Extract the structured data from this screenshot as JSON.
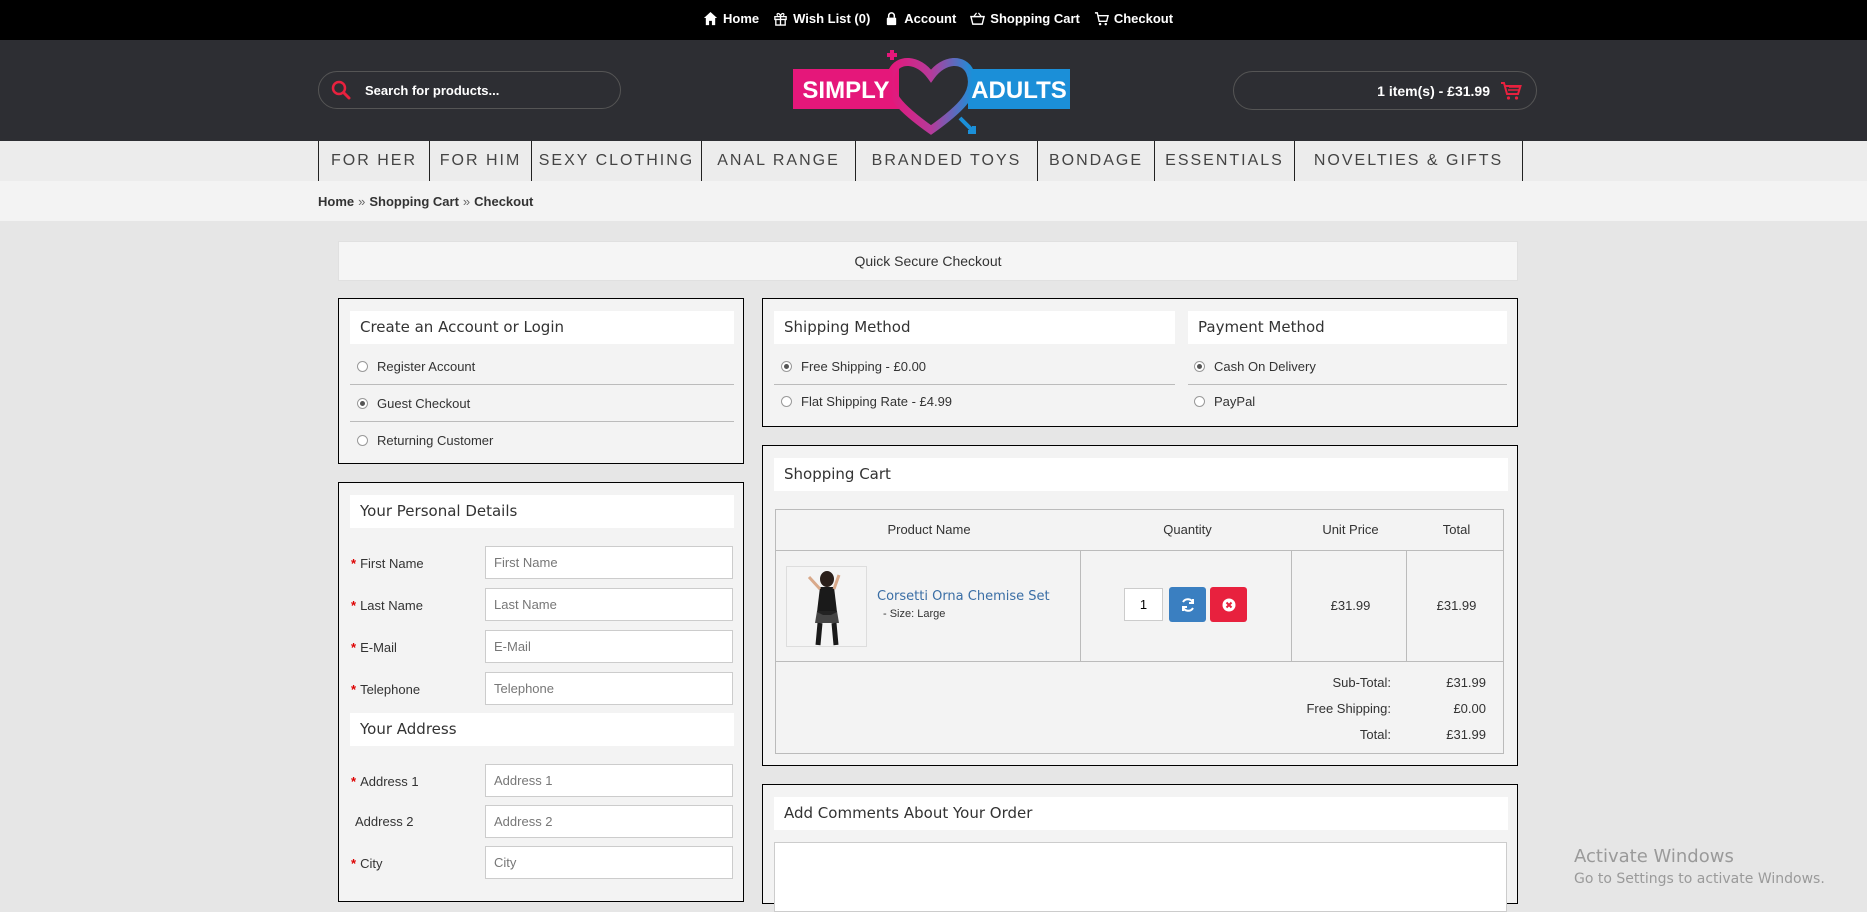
{
  "topnav": {
    "home": "Home",
    "wishlist": "Wish List (0)",
    "account": "Account",
    "cart": "Shopping Cart",
    "checkout": "Checkout"
  },
  "header": {
    "search_placeholder": "Search for products...",
    "cart_summary": "1 item(s) - £31.99",
    "logo_text_left": "SIMPLY",
    "logo_text_right": "ADULTS"
  },
  "mainnav": [
    "FOR HER",
    "FOR HIM",
    "SEXY CLOTHING",
    "ANAL RANGE",
    "BRANDED TOYS",
    "BONDAGE",
    "ESSENTIALS",
    "NOVELTIES & GIFTS"
  ],
  "breadcrumb": [
    "Home",
    "Shopping Cart",
    "Checkout"
  ],
  "breadcrumb_separator": "»",
  "quick_checkout": "Quick Secure Checkout",
  "account_panel": {
    "title": "Create an Account or Login",
    "options": [
      "Register Account",
      "Guest Checkout",
      "Returning Customer"
    ],
    "selected": "Guest Checkout"
  },
  "shipping_panel": {
    "title": "Shipping Method",
    "options": [
      "Free Shipping - £0.00",
      "Flat Shipping Rate - £4.99"
    ],
    "selected": "Free Shipping - £0.00"
  },
  "payment_panel": {
    "title": "Payment Method",
    "options": [
      "Cash On Delivery",
      "PayPal"
    ],
    "selected": "Cash On Delivery"
  },
  "personal": {
    "title": "Your Personal Details",
    "fields": [
      {
        "label": "First Name",
        "placeholder": "First Name",
        "required": "*"
      },
      {
        "label": "Last Name",
        "placeholder": "Last Name",
        "required": "*"
      },
      {
        "label": "E-Mail",
        "placeholder": "E-Mail",
        "required": "*"
      },
      {
        "label": "Telephone",
        "placeholder": "Telephone",
        "required": "*"
      }
    ]
  },
  "address": {
    "title": "Your Address",
    "fields": [
      {
        "label": "Address 1",
        "placeholder": "Address 1",
        "required": "*"
      },
      {
        "label": "Address 2",
        "placeholder": "Address 2",
        "required": ""
      },
      {
        "label": "City",
        "placeholder": "City",
        "required": "*"
      }
    ]
  },
  "cart": {
    "title": "Shopping Cart",
    "headers": [
      "Product Name",
      "Quantity",
      "Unit Price",
      "Total"
    ],
    "item": {
      "name": "Corsetti Orna Chemise Set",
      "option": "- Size: Large",
      "quantity": "1",
      "unit_price": "£31.99",
      "total": "£31.99"
    },
    "totals": [
      {
        "label": "Sub-Total:",
        "value": "£31.99"
      },
      {
        "label": "Free Shipping:",
        "value": "£0.00"
      },
      {
        "label": "Total:",
        "value": "£31.99"
      }
    ]
  },
  "comments": {
    "title": "Add Comments About Your Order"
  },
  "watermark": {
    "line1": "Activate Windows",
    "line2": "Go to Settings to activate Windows."
  },
  "colors": {
    "brand_pink": "#e5177a",
    "brand_blue": "#1b8fd8",
    "accent_red": "#e8213e",
    "button_blue": "#3a7fc1"
  }
}
